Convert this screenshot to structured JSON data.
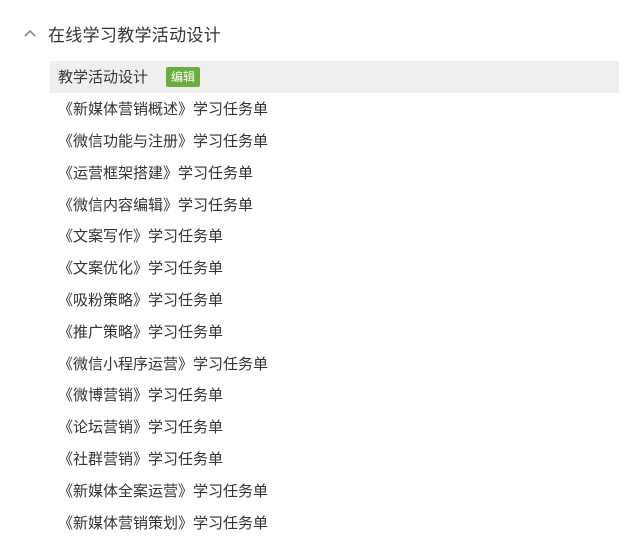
{
  "section": {
    "title": "在线学习教学活动设计",
    "expand_icon": "chevron-up-icon"
  },
  "active_item": {
    "label": "教学活动设计",
    "edit_label": "编辑"
  },
  "items": [
    "《新媒体营销概述》学习任务单",
    "《微信功能与注册》学习任务单",
    "《运营框架搭建》学习任务单",
    "《微信内容编辑》学习任务单",
    "《文案写作》学习任务单",
    "《文案优化》学习任务单",
    "《吸粉策略》学习任务单",
    "《推广策略》学习任务单",
    "《微信小程序运营》学习任务单",
    "《微博营销》学习任务单",
    "《论坛营销》学习任务单",
    "《社群营销》学习任务单",
    "《新媒体全案运营》学习任务单",
    "《新媒体营销策划》学习任务单"
  ],
  "colors": {
    "edit_badge": "#6cae3d",
    "active_row_bg": "#efefef",
    "text": "#333333"
  }
}
